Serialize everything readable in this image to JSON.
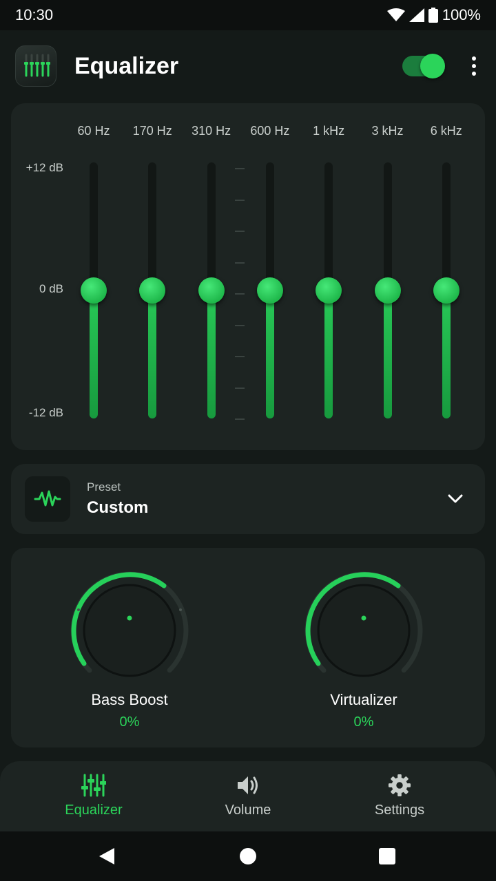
{
  "status_bar": {
    "time": "10:30",
    "battery": "100%"
  },
  "header": {
    "title": "Equalizer",
    "enabled": true
  },
  "equalizer": {
    "bands": [
      {
        "label": "60 Hz",
        "gain_db": 0
      },
      {
        "label": "170 Hz",
        "gain_db": 0
      },
      {
        "label": "310 Hz",
        "gain_db": 0
      },
      {
        "label": "600 Hz",
        "gain_db": 0
      },
      {
        "label": "1 kHz",
        "gain_db": 0
      },
      {
        "label": "3 kHz",
        "gain_db": 0
      },
      {
        "label": "6 kHz",
        "gain_db": 0
      }
    ],
    "scale": {
      "max_label": "+12 dB",
      "mid_label": "0 dB",
      "min_label": "-12 dB",
      "max_db": 12,
      "min_db": -12
    }
  },
  "preset": {
    "caption": "Preset",
    "value": "Custom"
  },
  "effects": {
    "bass_boost": {
      "label": "Bass Boost",
      "value": "0%"
    },
    "virtualizer": {
      "label": "Virtualizer",
      "value": "0%"
    }
  },
  "bottom_nav": {
    "items": [
      {
        "label": "Equalizer",
        "active": true
      },
      {
        "label": "Volume",
        "active": false
      },
      {
        "label": "Settings",
        "active": false
      }
    ]
  },
  "colors": {
    "accent": "#2bd45a",
    "background": "#141a18",
    "card": "#1d2422"
  }
}
